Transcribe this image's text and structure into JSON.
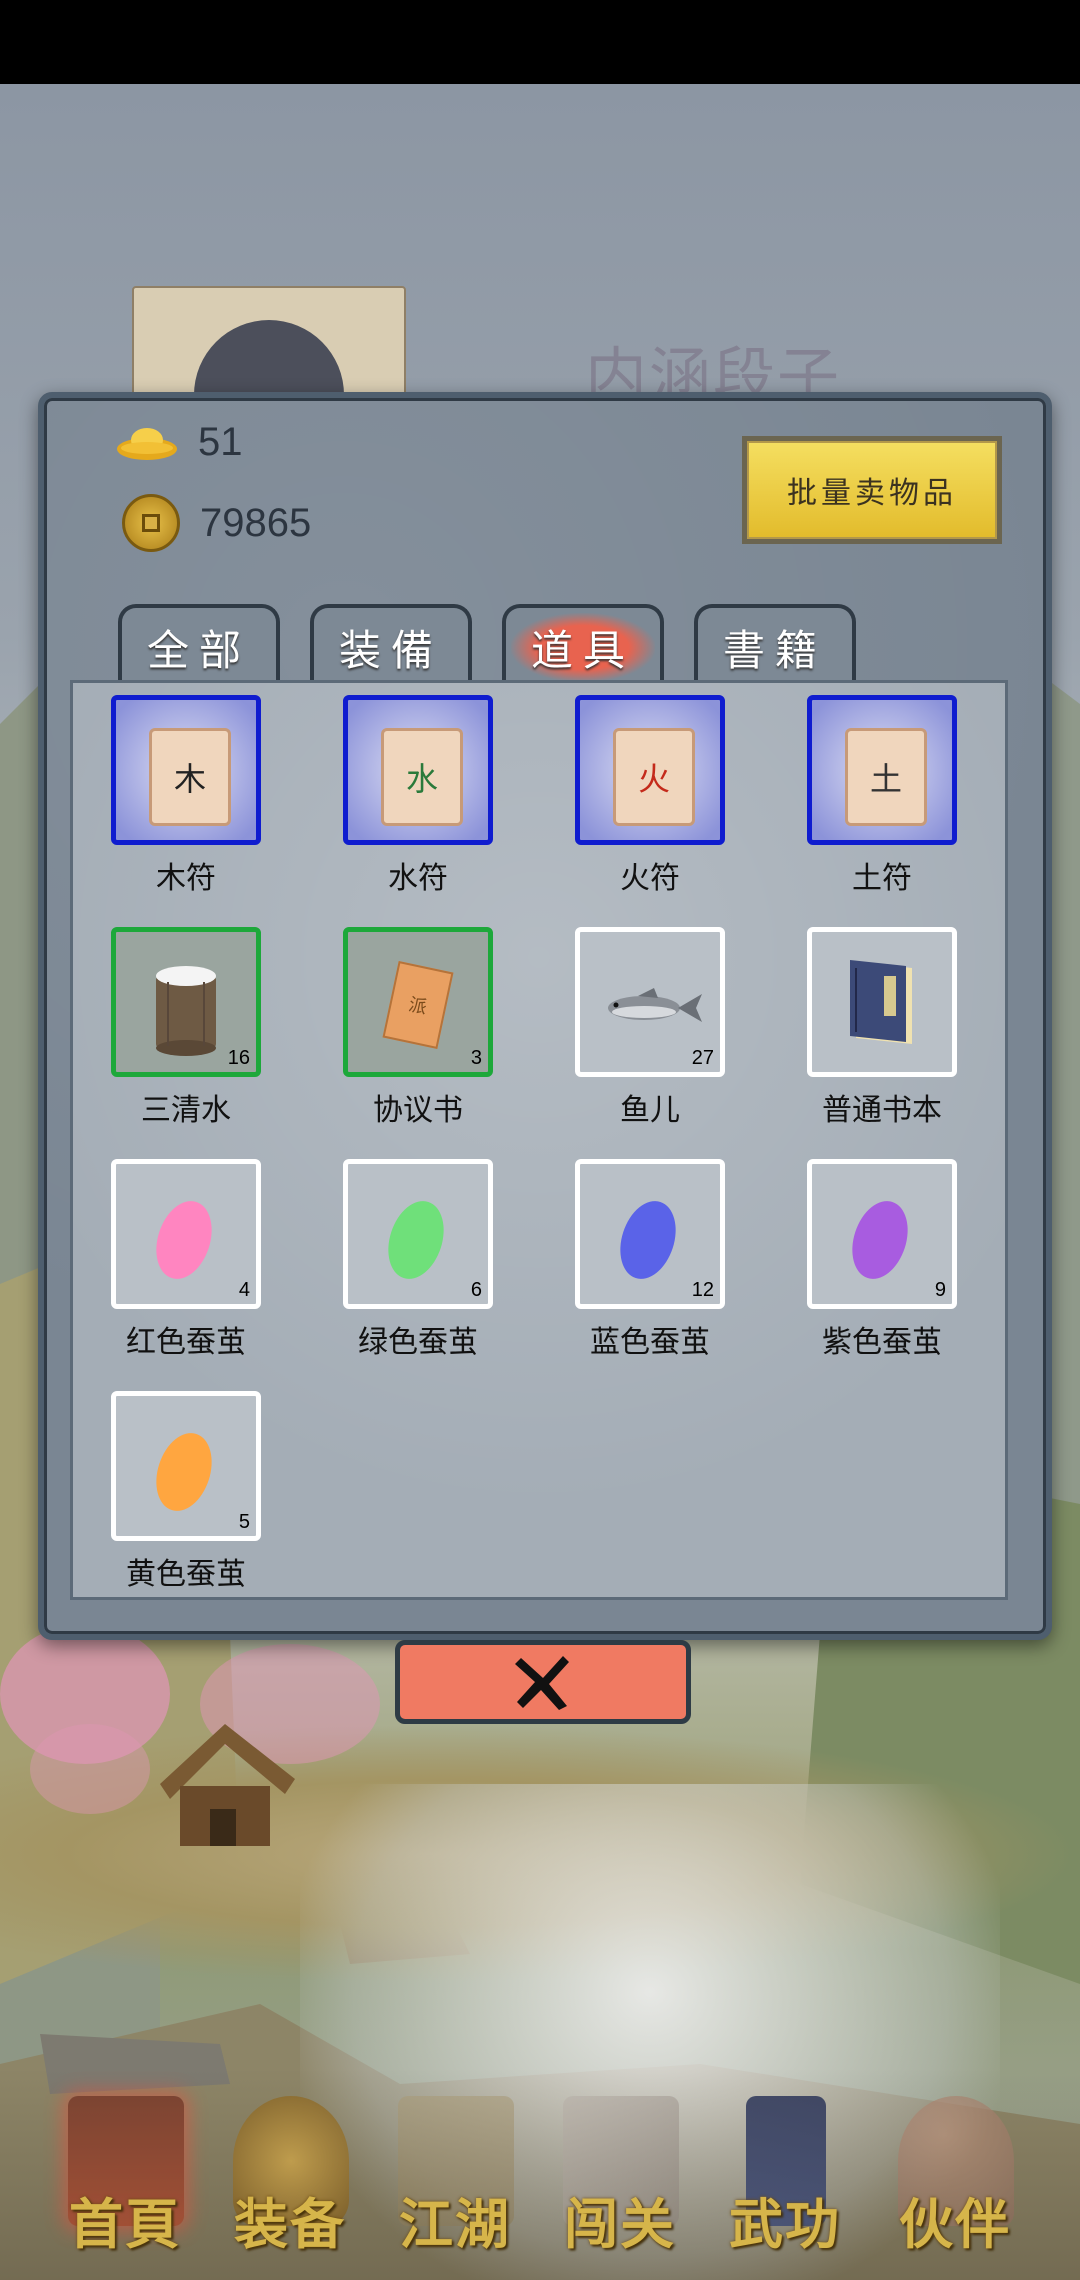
{
  "background": {
    "title": "内涵段子"
  },
  "currencies": [
    {
      "icon": "gold-ingot-icon",
      "value": "51"
    },
    {
      "icon": "copper-coin-icon",
      "value": "79865"
    }
  ],
  "sell_button": "批量卖物品",
  "tabs": [
    {
      "label": "全部",
      "active": false
    },
    {
      "label": "装備",
      "active": false
    },
    {
      "label": "道具",
      "active": true
    },
    {
      "label": "書籍",
      "active": false
    }
  ],
  "items": [
    {
      "name": "木符",
      "glyph": "木",
      "count": "",
      "rarity": "blue",
      "icon": "wood-talisman-icon"
    },
    {
      "name": "水符",
      "glyph": "水",
      "count": "",
      "rarity": "blue",
      "icon": "water-talisman-icon"
    },
    {
      "name": "火符",
      "glyph": "火",
      "count": "",
      "rarity": "blue",
      "icon": "fire-talisman-icon"
    },
    {
      "name": "土符",
      "glyph": "土",
      "count": "",
      "rarity": "blue",
      "icon": "earth-talisman-icon"
    },
    {
      "name": "三清水",
      "count": "16",
      "rarity": "green",
      "icon": "water-bucket-icon"
    },
    {
      "name": "协议书",
      "glyph": "派",
      "count": "3",
      "rarity": "green",
      "icon": "contract-scroll-icon"
    },
    {
      "name": "鱼儿",
      "count": "27",
      "rarity": "white",
      "icon": "fish-icon"
    },
    {
      "name": "普通书本",
      "count": "",
      "rarity": "white",
      "icon": "book-icon"
    },
    {
      "name": "红色蚕茧",
      "count": "4",
      "rarity": "white",
      "icon": "red-cocoon-icon",
      "color": "#ff7fbf"
    },
    {
      "name": "绿色蚕茧",
      "count": "6",
      "rarity": "white",
      "icon": "green-cocoon-icon",
      "color": "#6fe07a"
    },
    {
      "name": "蓝色蚕茧",
      "count": "12",
      "rarity": "white",
      "icon": "blue-cocoon-icon",
      "color": "#5a63e8"
    },
    {
      "name": "紫色蚕茧",
      "count": "9",
      "rarity": "white",
      "icon": "purple-cocoon-icon",
      "color": "#a85ce0"
    },
    {
      "name": "黄色蚕茧",
      "count": "5",
      "rarity": "white",
      "icon": "yellow-cocoon-icon",
      "color": "#ffa640"
    }
  ],
  "close_button": "close-x-icon",
  "bottom_nav": [
    {
      "label": "首頁",
      "icon": "home-temple-icon",
      "active": true
    },
    {
      "label": "装备",
      "icon": "armor-icon",
      "active": false
    },
    {
      "label": "江湖",
      "icon": "scroll-map-icon",
      "active": false
    },
    {
      "label": "闯关",
      "icon": "crossed-swords-icon",
      "active": false
    },
    {
      "label": "武功",
      "icon": "martial-book-icon",
      "active": false
    },
    {
      "label": "伙伴",
      "icon": "companions-icon",
      "active": false
    }
  ]
}
